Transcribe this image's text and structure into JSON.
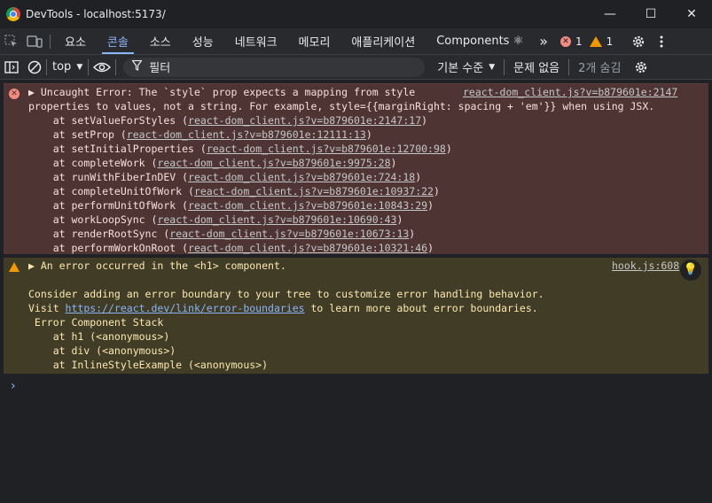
{
  "window": {
    "title": "DevTools - localhost:5173/",
    "minimize": "—",
    "maximize": "☐",
    "close": "✕"
  },
  "tabs": [
    {
      "label": "요소"
    },
    {
      "label": "콘솔",
      "active": true
    },
    {
      "label": "소스"
    },
    {
      "label": "성능"
    },
    {
      "label": "네트워크"
    },
    {
      "label": "메모리"
    },
    {
      "label": "애플리케이션"
    },
    {
      "label": "Components ⚛"
    }
  ],
  "counters": {
    "errors": "1",
    "warnings": "1",
    "more": "»"
  },
  "toolbar": {
    "context": "top",
    "filter_placeholder": "필터",
    "levels": "기본 수준",
    "issues": "문제 없음",
    "hidden": "2개 숨김"
  },
  "error": {
    "line1": "▶ Uncaught Error: The `style` prop expects a mapping from style",
    "line2": "properties to values, not a string. For example, style={{marginRight: spacing + 'em'}} when using JSX.",
    "source": "react-dom_client.js?v=b879601e:2147",
    "stack": [
      {
        "fn": "setValueForStyles",
        "loc": "react-dom_client.js?v=b879601e:2147:17"
      },
      {
        "fn": "setProp",
        "loc": "react-dom_client.js?v=b879601e:12111:13"
      },
      {
        "fn": "setInitialProperties",
        "loc": "react-dom_client.js?v=b879601e:12700:98"
      },
      {
        "fn": "completeWork",
        "loc": "react-dom_client.js?v=b879601e:9975:28"
      },
      {
        "fn": "runWithFiberInDEV",
        "loc": "react-dom_client.js?v=b879601e:724:18"
      },
      {
        "fn": "completeUnitOfWork",
        "loc": "react-dom_client.js?v=b879601e:10937:22"
      },
      {
        "fn": "performUnitOfWork",
        "loc": "react-dom_client.js?v=b879601e:10843:29"
      },
      {
        "fn": "workLoopSync",
        "loc": "react-dom_client.js?v=b879601e:10690:43"
      },
      {
        "fn": "renderRootSync",
        "loc": "react-dom_client.js?v=b879601e:10673:13"
      },
      {
        "fn": "performWorkOnRoot",
        "loc": "react-dom_client.js?v=b879601e:10321:46"
      }
    ]
  },
  "warning": {
    "line1": "▶ An error occurred in the <h1> component.",
    "source": "hook.js:608",
    "consider": "Consider adding an error boundary to your tree to customize error handling behavior.",
    "visit_pre": "Visit ",
    "visit_url": "https://react.dev/link/error-boundaries",
    "visit_post": " to learn more about error boundaries.",
    "stack_title": " Error Component Stack",
    "stack": [
      "    at h1 (<anonymous>)",
      "    at div (<anonymous>)",
      "    at InlineStyleExample (<anonymous>)"
    ]
  },
  "prompt": "›"
}
